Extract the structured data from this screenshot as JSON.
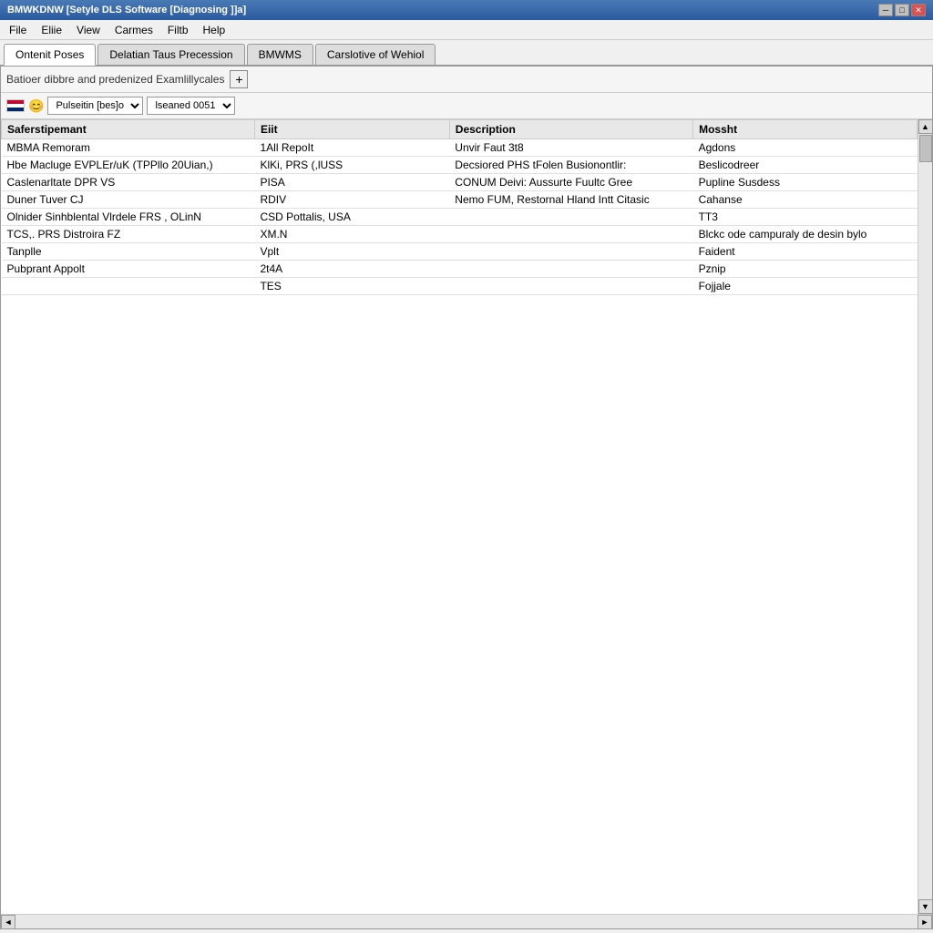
{
  "titleBar": {
    "title": "BMWKDNW [Setyle DLS Software [Diagnosing ]]a]",
    "minimizeLabel": "─",
    "maximizeLabel": "□",
    "closeLabel": "✕"
  },
  "menuBar": {
    "items": [
      {
        "label": "File"
      },
      {
        "label": "Eliie"
      },
      {
        "label": "View"
      },
      {
        "label": "Carmes"
      },
      {
        "label": "Filtb"
      },
      {
        "label": "Help"
      }
    ]
  },
  "tabs": [
    {
      "label": "Ontenit Poses",
      "active": true
    },
    {
      "label": "Delatian Taus Precession",
      "active": false
    },
    {
      "label": "BMWMS",
      "active": false
    },
    {
      "label": "Carslotive of Wehiol",
      "active": false
    }
  ],
  "toolbar": {
    "label": "Batioer dibbre and predenized Examlillycales",
    "addButtonLabel": "+"
  },
  "filters": {
    "flagAlt": "US flag",
    "smileyAlt": "smiley",
    "dropdown1Label": "Pulseitin [bes]o",
    "dropdown2Label": "lseaned 0051",
    "dropdown1Options": [
      "Pulseitin [bes]o"
    ],
    "dropdown2Options": [
      "lseaned 0051"
    ]
  },
  "table": {
    "columns": [
      {
        "key": "saferstipemant",
        "label": "Saferstipemant"
      },
      {
        "key": "edit",
        "label": "Eiit"
      },
      {
        "key": "description",
        "label": "Description"
      },
      {
        "key": "mosht",
        "label": "Mossht"
      }
    ],
    "rows": [
      {
        "saferstipemant": "MBMA Remoram",
        "edit": "1All RepoIt",
        "description": "Unvir Faut 3t8",
        "mosht": "Agdons"
      },
      {
        "saferstipemant": "Hbe Macluge EVPLEr/uK (TPPllo 20Uian,)",
        "edit": "KlKi, PRS (,lUSS",
        "description": "Decsiored PHS tFolen Busionontlir:",
        "mosht": "Beslicodreer"
      },
      {
        "saferstipemant": "Caslenarltate DPR VS",
        "edit": "PISA",
        "description": "CONUM Deivi: Aussurte Fuultc Gree",
        "mosht": "Pupline Susdess"
      },
      {
        "saferstipemant": "Duner Tuver CJ",
        "edit": "RDIV",
        "description": "Nemo FUM, Restornal Hland Intt Citasic",
        "mosht": "Cahanse"
      },
      {
        "saferstipemant": "Olnider Sinhblental Vlrdele FRS , OLinN",
        "edit": "CSD Pottalis, USA",
        "description": "",
        "mosht": "TT3"
      },
      {
        "saferstipemant": "TCS,. PRS Distroira FZ",
        "edit": "XM.N",
        "description": "",
        "mosht": "Blckc ode campuraly de desin bylo"
      },
      {
        "saferstipemant": "Tanplle",
        "edit": "Vplt",
        "description": "",
        "mosht": "Faident"
      },
      {
        "saferstipemant": "Pubprant Appolt",
        "edit": "2t4A",
        "description": "",
        "mosht": "Pznip"
      },
      {
        "saferstipemant": "",
        "edit": "TES",
        "description": "",
        "mosht": "Fojjale"
      }
    ]
  }
}
